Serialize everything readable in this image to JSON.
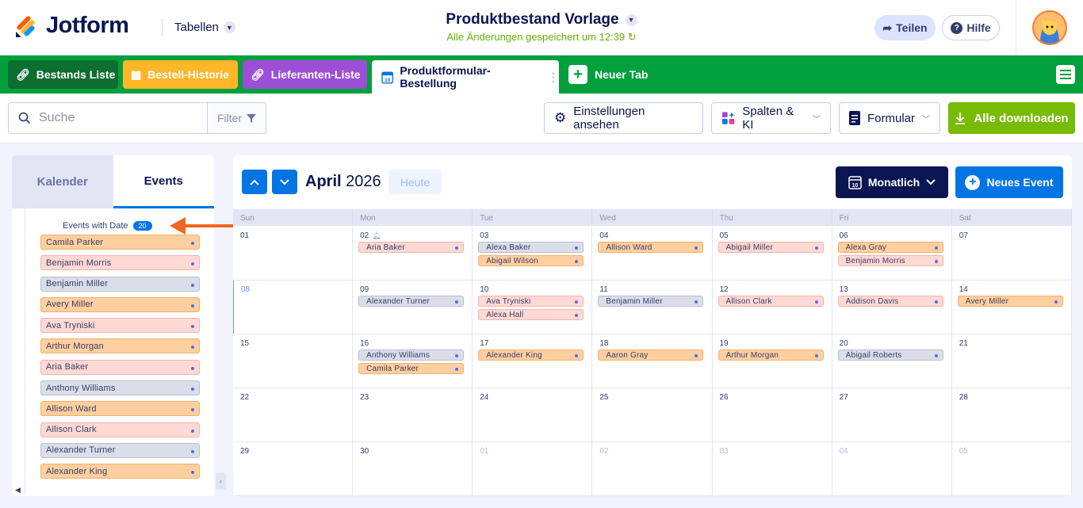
{
  "header": {
    "logo": "Jotform",
    "tables_label": "Tabellen",
    "title": "Produktbestand Vorlage",
    "saved": "Alle Änderungen gespeichert um 12:39",
    "share": "Teilen",
    "help": "Hilfe"
  },
  "tabs": [
    {
      "label": "Bestands Liste",
      "color": "#0c6e31"
    },
    {
      "label": "Bestell-Historie",
      "color": "#ffb629"
    },
    {
      "label": "Lieferanten-Liste",
      "color": "#9c4ed6"
    },
    {
      "label": "Produktformular-Bestellung",
      "color": "#ffffff"
    }
  ],
  "newtab": "Neuer Tab",
  "toolbar": {
    "search_placeholder": "Suche",
    "filter": "Filter",
    "settings": "Einstellungen ansehen",
    "columns": "Spalten & KI",
    "form": "Formular",
    "download": "Alle downloaden"
  },
  "sidebar": {
    "tab_calendar": "Kalender",
    "tab_events": "Events",
    "events_header": "Events with Date",
    "events_count": "20",
    "events": [
      {
        "name": "Camila Parker",
        "c": "c-or"
      },
      {
        "name": "Benjamin Morris",
        "c": "c-pk"
      },
      {
        "name": "Benjamin Miller",
        "c": "c-gr"
      },
      {
        "name": "Avery Miller",
        "c": "c-or"
      },
      {
        "name": "Ava Tryniski",
        "c": "c-pk"
      },
      {
        "name": "Arthur Morgan",
        "c": "c-or"
      },
      {
        "name": "Aria Baker",
        "c": "c-pk"
      },
      {
        "name": "Anthony Williams",
        "c": "c-gr"
      },
      {
        "name": "Allison Ward",
        "c": "c-or"
      },
      {
        "name": "Allison Clark",
        "c": "c-pk"
      },
      {
        "name": "Alexander Turner",
        "c": "c-gr"
      },
      {
        "name": "Alexander King",
        "c": "c-or"
      }
    ]
  },
  "calendar": {
    "month": "April",
    "year": "2026",
    "today": "Heute",
    "view": "Monatlich",
    "new_event": "Neues Event",
    "days": [
      "Sun",
      "Mon",
      "Tue",
      "Wed",
      "Thu",
      "Fri",
      "Sat"
    ],
    "weeks": [
      [
        {
          "d": "01"
        },
        {
          "d": "02",
          "bell": true,
          "ev": [
            [
              "Aria Baker",
              "c-pk"
            ]
          ]
        },
        {
          "d": "03",
          "ev": [
            [
              "Alexa Baker",
              "c-gr"
            ],
            [
              "Abigail Wilson",
              "c-or"
            ]
          ]
        },
        {
          "d": "04",
          "ev": [
            [
              "Allison Ward",
              "c-or"
            ]
          ]
        },
        {
          "d": "05",
          "ev": [
            [
              "Abigail Miller",
              "c-pk"
            ]
          ]
        },
        {
          "d": "06",
          "ev": [
            [
              "Alexa Gray",
              "c-or"
            ],
            [
              "Benjamin Morris",
              "c-pk"
            ]
          ]
        },
        {
          "d": "07"
        }
      ],
      [
        {
          "d": "08",
          "sel": true
        },
        {
          "d": "09",
          "ev": [
            [
              "Alexander Turner",
              "c-gr"
            ]
          ]
        },
        {
          "d": "10",
          "ev": [
            [
              "Ava Tryniski",
              "c-pk"
            ],
            [
              "Alexa Hall",
              "c-pk"
            ]
          ]
        },
        {
          "d": "11",
          "ev": [
            [
              "Benjamin Miller",
              "c-gr"
            ]
          ]
        },
        {
          "d": "12",
          "ev": [
            [
              "Allison Clark",
              "c-pk"
            ]
          ]
        },
        {
          "d": "13",
          "ev": [
            [
              "Addison Davis",
              "c-pk"
            ]
          ]
        },
        {
          "d": "14",
          "ev": [
            [
              "Avery Miller",
              "c-or"
            ]
          ]
        }
      ],
      [
        {
          "d": "15"
        },
        {
          "d": "16",
          "ev": [
            [
              "Anthony Williams",
              "c-gr"
            ],
            [
              "Camila Parker",
              "c-or"
            ]
          ]
        },
        {
          "d": "17",
          "ev": [
            [
              "Alexander King",
              "c-or"
            ]
          ]
        },
        {
          "d": "18",
          "ev": [
            [
              "Aaron Gray",
              "c-or"
            ]
          ]
        },
        {
          "d": "19",
          "ev": [
            [
              "Arthur Morgan",
              "c-or"
            ]
          ]
        },
        {
          "d": "20",
          "ev": [
            [
              "Abigail Roberts",
              "c-gr"
            ]
          ]
        },
        {
          "d": "21"
        }
      ],
      [
        {
          "d": "22"
        },
        {
          "d": "23"
        },
        {
          "d": "24"
        },
        {
          "d": "25"
        },
        {
          "d": "26"
        },
        {
          "d": "27"
        },
        {
          "d": "28"
        }
      ],
      [
        {
          "d": "29"
        },
        {
          "d": "30"
        },
        {
          "d": "01",
          "dim": true
        },
        {
          "d": "02",
          "dim": true
        },
        {
          "d": "03",
          "dim": true
        },
        {
          "d": "04",
          "dim": true
        },
        {
          "d": "05",
          "dim": true
        }
      ]
    ]
  }
}
